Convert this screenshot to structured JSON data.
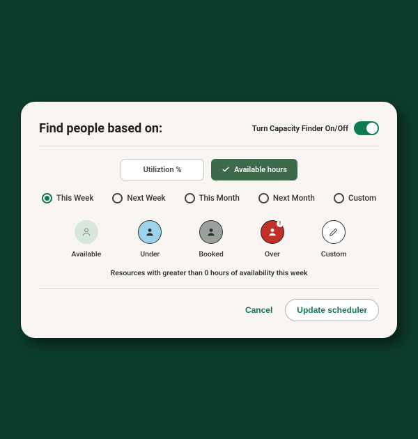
{
  "header": {
    "title": "Find people based on:",
    "toggle_label": "Turn Capacity Finder On/Off",
    "toggle_on": true
  },
  "mode": {
    "utilization_label": "Utiliztion %",
    "available_label": "Available hours",
    "selected": "available"
  },
  "ranges": [
    {
      "label": "This Week",
      "selected": true
    },
    {
      "label": "Next Week",
      "selected": false
    },
    {
      "label": "This Month",
      "selected": false
    },
    {
      "label": "Next Month",
      "selected": false
    },
    {
      "label": "Custom",
      "selected": false
    }
  ],
  "statuses": {
    "available": "Available",
    "under": "Under",
    "booked": "Booked",
    "over": "Over",
    "custom": "Custom"
  },
  "hint": "Resources with greater than 0 hours of availability this week",
  "actions": {
    "cancel": "Cancel",
    "update": "Update scheduler"
  }
}
